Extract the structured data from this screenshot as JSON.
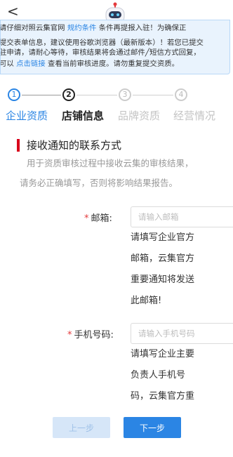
{
  "header": {
    "back_glyph": "<",
    "mascot": "robot-mascot-icon"
  },
  "notice": {
    "line1_a": "请仔细对照云集官网 ",
    "line1_link": "规约条件",
    "line1_b": " 条件再提报入驻！为确保正",
    "line2": "提交表单信息，建议使用谷歌浏览器（最新版本）！若您已提交",
    "line3": "驻申请，请耐心等待，审核结果将会通过邮件╱短信方式回复，",
    "line4_a": "可以  ",
    "line4_link": "点击链接",
    "line4_b": " 查看当前审核进度。请勿重复提交资质。"
  },
  "steps": [
    {
      "num": "1",
      "label": "企业资质"
    },
    {
      "num": "2",
      "label": "店铺信息"
    },
    {
      "num": "3",
      "label": "品牌资质"
    },
    {
      "num": "4",
      "label": "经营情况"
    }
  ],
  "section": {
    "title": "接收通知的联系方式",
    "desc1": "用于资质审核过程中接收云集的审核结果，",
    "desc2": "请务必正确填写，否则将影响结果报告。"
  },
  "form": {
    "email": {
      "required_mark": "*",
      "label": "邮箱:",
      "placeholder": "请输入邮箱",
      "value": "",
      "hint_lines": [
        "请填写企业官方",
        "邮箱，云集官方",
        "重要通知将发送",
        "此邮箱!"
      ]
    },
    "phone": {
      "required_mark": "*",
      "label": "手机号码:",
      "placeholder": "请输入手机号码",
      "value": "",
      "hint_lines": [
        "请填写企业主要",
        "负责人手机号",
        "码，云集官方重"
      ]
    }
  },
  "buttons": {
    "prev": "上一步",
    "next": "下一步"
  },
  "colors": {
    "accent": "#2b85e4",
    "required": "#e4393c",
    "section_bar": "#d9001b"
  }
}
